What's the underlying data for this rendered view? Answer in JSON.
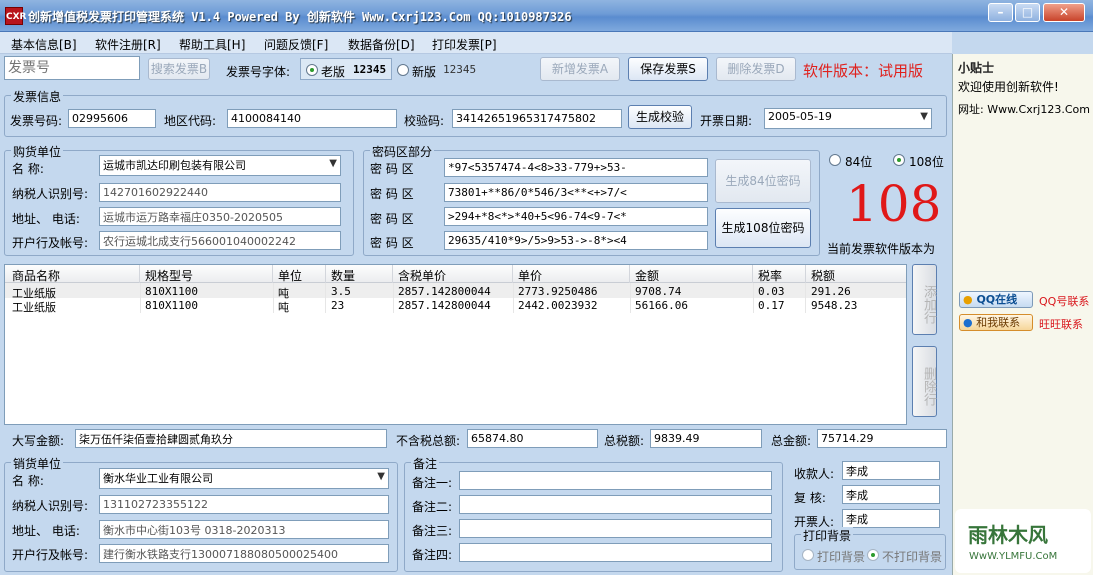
{
  "window": {
    "title": "创新增值税发票打印管理系统 V1.4 Powered By 创新软件 Www.Cxrj123.Com QQ:1010987326",
    "icon": "CXR"
  },
  "menu": [
    "基本信息[B]",
    "软件注册[R]",
    "帮助工具[H]",
    "问题反馈[F]",
    "数据备份[D]",
    "打印发票[P]"
  ],
  "toolbar": {
    "search_placeholder": "发票号",
    "search_button": "搜索发票B",
    "font_label": "发票号字体:",
    "old_font_label": "老版",
    "old_font_sample": "12345",
    "new_font_label": "新版",
    "new_font_sample": "12345",
    "add_button": "新增发票A",
    "save_button": "保存发票S",
    "delete_button": "删除发票D",
    "version_notice": "软件版本：试用版"
  },
  "invoice": {
    "group_title": "发票信息",
    "number_label": "发票号码:",
    "number": "02995606",
    "region_label": "地区代码:",
    "region": "4100084140",
    "check_label": "校验码:",
    "check": "34142651965317475802",
    "gen_check_button": "生成校验",
    "date_label": "开票日期:",
    "date": "2005-05-19"
  },
  "buyer": {
    "group_title": "购货单位",
    "name_label": "名    称:",
    "name": "运城市凯达印刷包装有限公司",
    "tax_label": "纳税人识别号:",
    "tax_id": "142701602922440",
    "addr_label": "地址、 电话:",
    "addr": "运城市运万路幸福庄0350-2020505",
    "bank_label": "开户行及帐号:",
    "bank": "农行运城北成支行566001040002242"
  },
  "cipher": {
    "group_title": "密码区部分",
    "row_label": "密 码 区",
    "rows": [
      "*97<5357474-4<8>33-779+>53-",
      "73801+**86/0*546/3<**<+>7/<",
      ">294+*8<*>*40+5<96-74<9-7<*",
      "29635/410*9>/5>9>53->-8*><4"
    ],
    "gen84_button": "生成84位密码",
    "gen108_button": "生成108位密码",
    "opt84": "84位",
    "opt108": "108位",
    "version_big": "108",
    "version_caption": "当前发票软件版本为"
  },
  "items": {
    "columns": [
      "商品名称",
      "规格型号",
      "单位",
      "数量",
      "含税单价",
      "单价",
      "金额",
      "税率",
      "税额"
    ],
    "rows": [
      [
        "工业纸版",
        "810X1100",
        "吨",
        "3.5",
        "2857.142800044",
        "2773.9250486",
        "9708.74",
        "0.03",
        "291.26"
      ],
      [
        "工业纸版",
        "810X1100",
        "吨",
        "23",
        "2857.142800044",
        "2442.0023932",
        "56166.06",
        "0.17",
        "9548.23"
      ]
    ],
    "add_row_button": "添加行",
    "delete_row_button": "删除行"
  },
  "totals": {
    "caps_label": "大写金额:",
    "caps": "柒万伍仟柒佰壹拾肆圆贰角玖分",
    "pretax_label": "不含税总额:",
    "pretax": "65874.80",
    "tax_label": "总税额:",
    "tax": "9839.49",
    "total_label": "总金额:",
    "total": "75714.29"
  },
  "seller": {
    "group_title": "销货单位",
    "name_label": "名    称:",
    "name": "衡水华业工业有限公司",
    "tax_label": "纳税人识别号:",
    "tax_id": "131102723355122",
    "addr_label": "地址、 电话:",
    "addr": "衡水市中心街103号 0318-2020313",
    "bank_label": "开户行及帐号:",
    "bank": "建行衡水铁路支行130007188080500025400"
  },
  "notes": {
    "group_title": "备注",
    "labels": [
      "备注一:",
      "备注二:",
      "备注三:",
      "备注四:"
    ]
  },
  "people": {
    "payee_label": "收款人:",
    "payee": "李成",
    "review_label": "复  核:",
    "review": "李成",
    "issuer_label": "开票人:",
    "issuer": "李成",
    "bg_group_title": "打印背景",
    "bg_print": "打印背景",
    "bg_noprint": "不打印背景"
  },
  "side": {
    "tip_title": "小贴士",
    "welcome": "欢迎使用创新软件!",
    "site": "网址: Www.Cxrj123.Com",
    "qq_badge": "QQ在线",
    "qq_link": "QQ号联系",
    "ww_badge": "和我联系",
    "ww_link": "旺旺联系",
    "watermark": "雨林木风",
    "watermark_url": "WwW.YLMFU.CoM"
  }
}
